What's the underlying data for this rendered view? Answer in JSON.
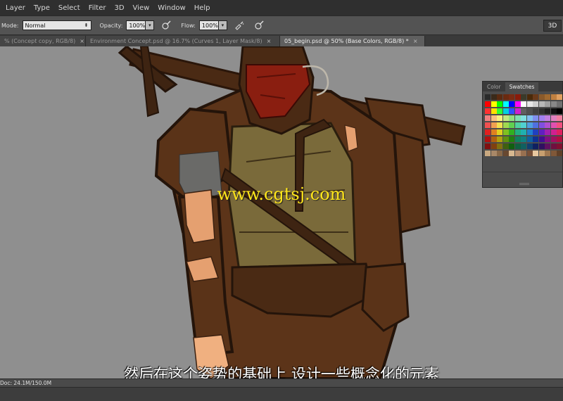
{
  "menu": [
    "Layer",
    "Type",
    "Select",
    "Filter",
    "3D",
    "View",
    "Window",
    "Help"
  ],
  "options": {
    "mode_label": "Mode:",
    "mode_value": "Normal",
    "opacity_label": "Opacity:",
    "opacity_value": "100%",
    "flow_label": "Flow:",
    "flow_value": "100%",
    "workspace_button": "3D"
  },
  "tabs": [
    {
      "label": "% (Concept copy, RGB/8)",
      "close": "×",
      "active": false
    },
    {
      "label": "Environment Concept.psd @ 16.7% (Curves 1, Layer Mask/8)",
      "close": "×",
      "active": false
    },
    {
      "label": "05_begin.psd @ 50% (Base Colors, RGB/8) *",
      "close": "×",
      "active": true
    }
  ],
  "watermark": "www.cgtsj.com",
  "panel": {
    "tabs": [
      "Color",
      "Swatches"
    ],
    "active_tab": "Swatches",
    "swatch_rows": [
      [
        "#2a2a2a",
        "#3a2a1a",
        "#5a2a10",
        "#6a2a10",
        "#7a2a12",
        "#8a1a0a",
        "#3a3a2a",
        "#4a2a0a",
        "#6a3a1a",
        "#8a5a2a",
        "#a06a30",
        "#c08040",
        "#e0a060"
      ],
      [
        "#ff0000",
        "#ffff00",
        "#00ff00",
        "#00ffff",
        "#0000ff",
        "#ff00ff",
        "#ffffff",
        "#e8e8e8",
        "#d0d0d0",
        "#b8b8b8",
        "#a0a0a0",
        "#888888",
        "#707070"
      ],
      [
        "#ff3030",
        "#ffe000",
        "#30ff30",
        "#00d0e0",
        "#3050ff",
        "#d020d0",
        "#606060",
        "#505050",
        "#404040",
        "#303030",
        "#202020",
        "#101010",
        "#000000"
      ],
      [
        "#f08080",
        "#f8c080",
        "#f8f080",
        "#c0e880",
        "#90e080",
        "#80e0b0",
        "#80e0e0",
        "#80c0f0",
        "#8090f0",
        "#a080f0",
        "#c080e0",
        "#e080c0",
        "#f080a0"
      ],
      [
        "#f05050",
        "#f0a050",
        "#f0e050",
        "#a0d850",
        "#60d050",
        "#50d0a0",
        "#50d0d0",
        "#50a0e0",
        "#5070e0",
        "#8050e0",
        "#b050d0",
        "#e050b0",
        "#f05080"
      ],
      [
        "#e02020",
        "#e08020",
        "#e0d020",
        "#80c020",
        "#30b020",
        "#20b080",
        "#20b0b0",
        "#2080d0",
        "#2040c0",
        "#6020c0",
        "#a020b0",
        "#d02090",
        "#e02060"
      ],
      [
        "#b01010",
        "#b06010",
        "#b0a010",
        "#609010",
        "#208010",
        "#108060",
        "#108080",
        "#1060a0",
        "#103090",
        "#401090",
        "#801080",
        "#a01060",
        "#b01040"
      ],
      [
        "#801010",
        "#804010",
        "#807010",
        "#406010",
        "#106010",
        "#106040",
        "#106060",
        "#104070",
        "#102060",
        "#301060",
        "#601060",
        "#701040",
        "#801030"
      ],
      [
        "#c8a880",
        "#a88868",
        "#886848",
        "#684830",
        "#d8b890",
        "#b89070",
        "#987050",
        "#785038",
        "#e8c8a0",
        "#c8a070",
        "#a07850",
        "#805838",
        "#604028"
      ]
    ]
  },
  "subtitle": "然后在这个姿势的基础上 设计一些概念化的元素",
  "status": {
    "doc": "Doc: 24.1M/150.0M"
  }
}
